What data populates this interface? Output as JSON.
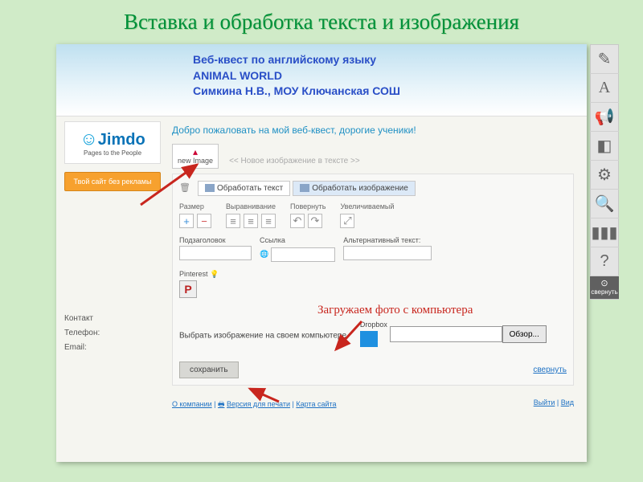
{
  "slide_title": "Вставка и обработка текста и изображения",
  "header": {
    "line1": "Веб-квест по английскому языку",
    "line2": "ANIMAL WORLD",
    "line3": "Симкина Н.В., МОУ Ключанская СОШ"
  },
  "sidebar": {
    "logo_text": "Jimdo",
    "tagline": "Pages to the People",
    "orange_btn": "Твой сайт без рекламы",
    "contact": "Контакт",
    "phone": "Телефон:",
    "email": "Email:"
  },
  "content": {
    "welcome": "Добро пожаловать на мой веб-квест, дорогие ученики!",
    "new_image": "new Image",
    "placeholder_row": "<< Новое изображение в тексте >>",
    "tabs": {
      "text": "Обработать текст",
      "image": "Обработать изображение"
    },
    "toolbar": {
      "size": "Размер",
      "align": "Выравнивание",
      "rotate": "Повернуть",
      "zoom": "Увеличиваемый"
    },
    "fields": {
      "subtitle": "Подзаголовок",
      "link": "Ссылка",
      "alt": "Альтернативный текст:"
    },
    "pinterest": "Pinterest",
    "upload": {
      "label": "Выбрать изображение на своем компьютере",
      "browse": "Обзор...",
      "dropbox": "Dropbox"
    },
    "save": "сохранить",
    "collapse": "свернуть",
    "footer": {
      "about": "О компании",
      "print": "Версия для печати",
      "sitemap": "Карта сайта",
      "logout": "Выйти",
      "view": "Вид"
    }
  },
  "right_toolbar": {
    "collapse": "свернуть"
  },
  "annotation": {
    "upload": "Загружаем фото с компьютера"
  }
}
